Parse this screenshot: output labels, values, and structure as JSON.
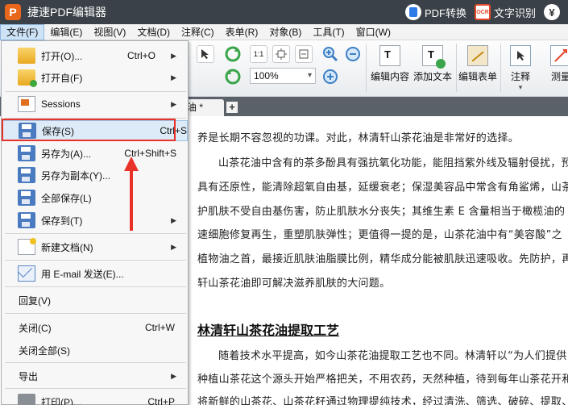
{
  "titlebar": {
    "logo": "P",
    "title": "捷速PDF编辑器",
    "pdf_convert": "PDF转换",
    "ocr_badge": "OCR",
    "ocr_label": "文字识别",
    "yen": "¥"
  },
  "menubar": [
    "文件(F)",
    "编辑(E)",
    "视图(V)",
    "文档(D)",
    "注释(C)",
    "表单(R)",
    "对象(B)",
    "工具(T)",
    "窗口(W)"
  ],
  "toolbar": {
    "page_indicator": "1:1",
    "zoom": "100%",
    "tools": [
      "编辑内容",
      "添加文本",
      "编辑表单",
      "注释",
      "测量"
    ]
  },
  "tab": {
    "name": "油 *",
    "add": "+"
  },
  "document": {
    "lines": [
      "养是长期不容忽视的功课。对此，林清轩山茶花油是非常好的选择。",
      "山茶花油中含有的茶多酚具有强抗氧化功能，能阻挡紫外线及辐射侵扰，预",
      "具有还原性，能清除超氧自由基，延缓衰老；保湿美容品中常含有角鲨烯，山茶",
      "护肌肤不受自由基伤害，防止肌肤水分丧失；其维生素 E 含量相当于橄榄油的",
      "速细胞修复再生，重塑肌肤弹性；更值得一提的是，山茶花油中有“美容酸”之",
      "植物油之首，最接近肌肤油脂膜比例，精华成分能被肌肤迅速吸收。先防护，再",
      "轩山茶花油即可解决滋养肌肤的大问题。"
    ],
    "heading": "林清轩山茶花油提取工艺",
    "lines2": [
      "随着技术水平提高，如今山茶花油提取工艺也不同。林清轩以“为人们提供",
      "种植山茶花这个源头开始严格把关，不用农药，天然种植，待到每年山茶花开和",
      "将新鲜的山茶花、山茶花籽通过物理提纯技术，经过清洗、筛选、破碎、提取、"
    ]
  },
  "file_menu": {
    "items": [
      {
        "label": "打开(O)...",
        "shortcut": "Ctrl+O",
        "arrow": "▶"
      },
      {
        "label": "打开自(F)",
        "shortcut": "",
        "arrow": "▶"
      },
      {
        "label": "Sessions",
        "shortcut": "",
        "arrow": "▶"
      },
      {
        "label": "保存(S)",
        "shortcut": "Ctrl+S",
        "arrow": ""
      },
      {
        "label": "另存为(A)...",
        "shortcut": "Ctrl+Shift+S",
        "arrow": ""
      },
      {
        "label": "另存为副本(Y)...",
        "shortcut": "",
        "arrow": ""
      },
      {
        "label": "全部保存(L)",
        "shortcut": "",
        "arrow": ""
      },
      {
        "label": "保存到(T)",
        "shortcut": "",
        "arrow": "▶"
      },
      {
        "label": "新建文档(N)",
        "shortcut": "",
        "arrow": "▶"
      },
      {
        "label": "用 E-mail 发送(E)...",
        "shortcut": "",
        "arrow": ""
      },
      {
        "label": "回复(V)",
        "shortcut": "",
        "arrow": ""
      },
      {
        "label": "关闭(C)",
        "shortcut": "Ctrl+W",
        "arrow": ""
      },
      {
        "label": "关闭全部(S)",
        "shortcut": "",
        "arrow": ""
      },
      {
        "label": "导出",
        "shortcut": "",
        "arrow": "▶"
      },
      {
        "label": "打印(P)...",
        "shortcut": "Ctrl+P",
        "arrow": ""
      }
    ]
  },
  "colors": {
    "titlebar": "#3a4148",
    "highlight": "#ddeaf7",
    "annotation_red": "#e8332a"
  }
}
